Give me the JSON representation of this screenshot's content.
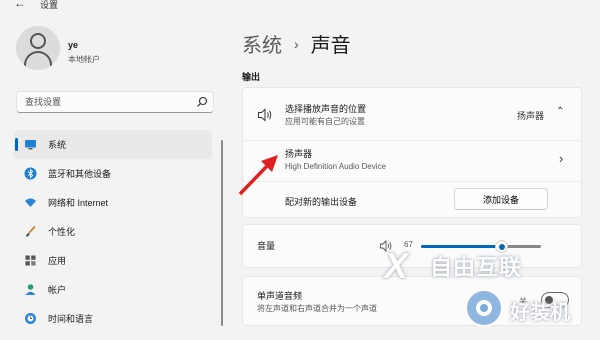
{
  "window": {
    "title": "设置"
  },
  "user": {
    "name": "ye",
    "account_type": "本地帐户"
  },
  "search": {
    "placeholder": "查找设置"
  },
  "sidebar": {
    "items": [
      {
        "label": "系统",
        "icon": "monitor-icon",
        "active": true
      },
      {
        "label": "蓝牙和其他设备",
        "icon": "bluetooth-icon"
      },
      {
        "label": "网络和 Internet",
        "icon": "wifi-icon"
      },
      {
        "label": "个性化",
        "icon": "brush-icon"
      },
      {
        "label": "应用",
        "icon": "apps-icon"
      },
      {
        "label": "帐户",
        "icon": "account-icon"
      },
      {
        "label": "时间和语言",
        "icon": "clock-globe-icon"
      }
    ]
  },
  "breadcrumb": {
    "parent": "系统",
    "separator": "›",
    "current": "声音"
  },
  "output": {
    "section_label": "输出",
    "choose_title": "选择播放声音的位置",
    "choose_subtitle": "应用可能有自己的设置",
    "choose_value": "扬声器",
    "speaker_title": "扬声器",
    "speaker_subtitle": "High Definition Audio Device",
    "pair_label": "配对新的输出设备",
    "add_device_button": "添加设备"
  },
  "volume": {
    "label": "音量",
    "value": "67",
    "level": 0.67
  },
  "mono": {
    "title": "单声道音频",
    "subtitle": "将左声道和右声道合并为一个声道",
    "toggle_label": "关"
  },
  "watermark": {
    "brand": "自由互联",
    "x_mark": "X",
    "site": "好装机"
  },
  "colors": {
    "accent": "#0067c0",
    "arrow": "#e02020",
    "background": "#f3f3f3",
    "card": "#fbfbfb"
  }
}
